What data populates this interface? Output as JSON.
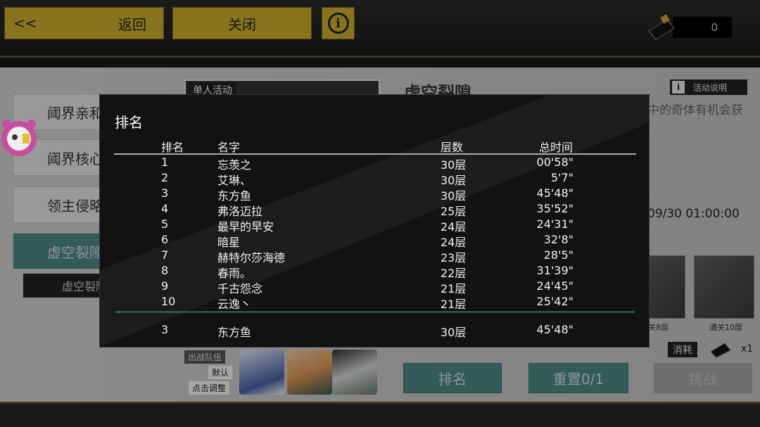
{
  "topbar": {
    "back_arrows": "<<",
    "back_label": "返回",
    "close_label": "关闭",
    "info_symbol": "i",
    "currency_value": "0"
  },
  "background": {
    "sidebar_items": [
      "阈界亲和测",
      "阈界核心",
      "领主侵略",
      "虚空裂隙"
    ],
    "sub_item": "虚空裂隙",
    "card_tag": "单人活动",
    "event_title": "虚空裂隙",
    "activity_desc_label": "活动说明",
    "desc_fragment": "中的奇体有机会获",
    "time_fragment": "09/30 01:00:00",
    "reward_labels": [
      "关8层",
      "通关10层"
    ],
    "team_labels": [
      "出战队伍",
      "默认",
      "点击调整"
    ],
    "consume_label": "消耗",
    "consume_count": "x1",
    "buttons": {
      "rank": "排名",
      "reset": "重置0/1",
      "challenge": "挑战"
    }
  },
  "ranking": {
    "title": "排名",
    "headers": {
      "rank": "排名",
      "name": "名字",
      "floors": "层数",
      "time": "总时间"
    },
    "rows": [
      {
        "rank": "1",
        "name": "忘羡之",
        "floors": "30层",
        "time": "00'58\""
      },
      {
        "rank": "2",
        "name": "艾琳、",
        "floors": "30层",
        "time": "5'7\""
      },
      {
        "rank": "3",
        "name": "东方鱼",
        "floors": "30层",
        "time": "45'48\""
      },
      {
        "rank": "4",
        "name": "弗洛迈拉",
        "floors": "25层",
        "time": "35'52\""
      },
      {
        "rank": "5",
        "name": "最早的早安",
        "floors": "24层",
        "time": "24'31\""
      },
      {
        "rank": "6",
        "name": "暗星",
        "floors": "24层",
        "time": "32'8\""
      },
      {
        "rank": "7",
        "name": "赫特尔莎海德",
        "floors": "23层",
        "time": "28'5\""
      },
      {
        "rank": "8",
        "name": "春雨。",
        "floors": "22层",
        "time": "31'39\""
      },
      {
        "rank": "9",
        "name": "千古怨念",
        "floors": "21层",
        "time": "24'45\""
      },
      {
        "rank": "10",
        "name": "云逸丶",
        "floors": "21层",
        "time": "25'42\""
      }
    ],
    "self_row": {
      "rank": "3",
      "name": "东方鱼",
      "floors": "30层",
      "time": "45'48\""
    }
  }
}
